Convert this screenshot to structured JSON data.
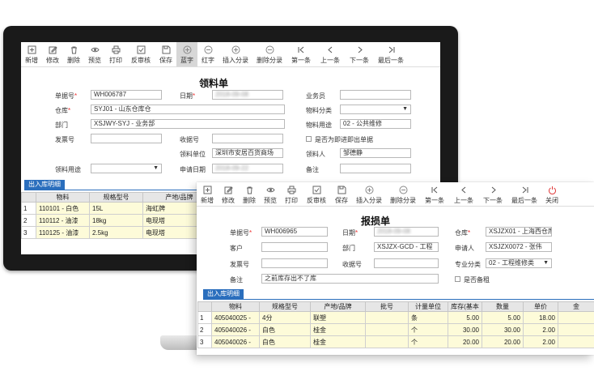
{
  "back_window": {
    "toolbar": [
      {
        "label": "新增",
        "icon": "new-doc-icon"
      },
      {
        "label": "修改",
        "icon": "edit-icon"
      },
      {
        "label": "删除",
        "icon": "trash-icon"
      },
      {
        "label": "预览",
        "icon": "eye-icon"
      },
      {
        "label": "打印",
        "icon": "printer-icon"
      },
      {
        "label": "反审核",
        "icon": "unaudit-icon"
      },
      {
        "label": "保存",
        "icon": "save-icon"
      },
      {
        "label": "蓝字",
        "icon": "add-circle-icon"
      },
      {
        "label": "红字",
        "icon": "minus-circle-icon"
      },
      {
        "label": "插入分录",
        "icon": "add-circle-icon"
      },
      {
        "label": "删除分录",
        "icon": "minus-circle-icon"
      },
      {
        "label": "第一条",
        "icon": "first-icon"
      },
      {
        "label": "上一条",
        "icon": "prev-icon"
      },
      {
        "label": "下一条",
        "icon": "next-icon"
      },
      {
        "label": "最后一条",
        "icon": "last-icon"
      }
    ],
    "title": "领料单",
    "fields": {
      "doc_no_label": "单据号",
      "doc_no_value": "WH006787",
      "date_label": "日期",
      "date_value": "2018-09-08",
      "clerk_label": "业务员",
      "clerk_value": "",
      "warehouse_label": "仓库",
      "warehouse_value": "SYJ01 - 山东仓库仓",
      "category_label": "物料分类",
      "category_value": "",
      "dept_label": "部门",
      "dept_value": "XSJWY-SYJ - 业务部",
      "purpose_label": "物料用途",
      "purpose_value": "02 - 公共维修",
      "invoice_label": "发票号",
      "invoice_value": "",
      "receipt_label": "收据号",
      "receipt_value": "",
      "instant_label": "是否为即进即出单据",
      "unit_label": "领料单位",
      "unit_value": "深圳市安居百货商场",
      "receiver_label": "领料人",
      "receiver_value": "邹德静",
      "use_label": "领料用途",
      "use_value": "",
      "apply_date_label": "申请日期",
      "apply_date_value": "2018-09-22",
      "remark_label": "备注",
      "remark_value": ""
    },
    "tab_label": "出入库明细",
    "grid": {
      "headers": [
        "",
        "物料",
        "规格型号",
        "产地/品牌"
      ],
      "rows": [
        {
          "idx": "1",
          "item": "110101 - 白色",
          "spec": "15L",
          "brand": "海虹牌"
        },
        {
          "idx": "2",
          "item": "110112 - 油漆",
          "spec": "18kg",
          "brand": "电现塔"
        },
        {
          "idx": "3",
          "item": "110125 - 油漆",
          "spec": "2.5kg",
          "brand": "电现塔"
        }
      ]
    }
  },
  "front_window": {
    "toolbar": [
      {
        "label": "新增",
        "icon": "new-doc-icon"
      },
      {
        "label": "修改",
        "icon": "edit-icon"
      },
      {
        "label": "删除",
        "icon": "trash-icon"
      },
      {
        "label": "预览",
        "icon": "eye-icon"
      },
      {
        "label": "打印",
        "icon": "printer-icon"
      },
      {
        "label": "反审核",
        "icon": "unaudit-icon"
      },
      {
        "label": "保存",
        "icon": "save-icon"
      },
      {
        "label": "插入分录",
        "icon": "add-circle-icon"
      },
      {
        "label": "删除分录",
        "icon": "minus-circle-icon"
      },
      {
        "label": "第一条",
        "icon": "first-icon"
      },
      {
        "label": "上一条",
        "icon": "prev-icon"
      },
      {
        "label": "下一条",
        "icon": "next-icon"
      },
      {
        "label": "最后一条",
        "icon": "last-icon"
      },
      {
        "label": "关闭",
        "icon": "power-icon"
      }
    ],
    "title": "报损单",
    "fields": {
      "doc_no_label": "单据号",
      "doc_no_value": "WH006965",
      "date_label": "日期",
      "date_value": "2018-09-08",
      "warehouse_label": "仓库",
      "warehouse_value": "XSJZX01 - 上海西仓库",
      "customer_label": "客户",
      "customer_value": "",
      "dept_label": "部门",
      "dept_value": "XSJZX-GCD - 工程",
      "applicant_label": "申请人",
      "applicant_value": "XSJZX0072 - 张伟",
      "invoice_label": "发票号",
      "invoice_value": "",
      "receipt_label": "收据号",
      "receipt_value": "",
      "category_label": "专业分类",
      "category_value": "02 - 工程维修类",
      "remark_label": "备注",
      "remark_value": "之前库存出不了库",
      "flag_label": "是否备租"
    },
    "tab_label": "出入库明细",
    "grid": {
      "headers": [
        "",
        "物料",
        "规格型号",
        "产地/品牌",
        "批号",
        "计量单位",
        "库存(基本",
        "数量",
        "单价",
        "金"
      ],
      "rows": [
        {
          "idx": "1",
          "item": "405040025 -",
          "spec": "4分",
          "brand": "联塑",
          "batch": "",
          "unit": "条",
          "stock": "5.00",
          "qty": "5.00",
          "price": "18.00",
          "amt": ""
        },
        {
          "idx": "2",
          "item": "405040026 -",
          "spec": "白色",
          "brand": "桂金",
          "batch": "",
          "unit": "个",
          "stock": "30.00",
          "qty": "30.00",
          "price": "2.00",
          "amt": ""
        },
        {
          "idx": "3",
          "item": "405040026 -",
          "spec": "白色",
          "brand": "桂金",
          "batch": "",
          "unit": "个",
          "stock": "20.00",
          "qty": "20.00",
          "price": "2.00",
          "amt": ""
        }
      ]
    }
  }
}
